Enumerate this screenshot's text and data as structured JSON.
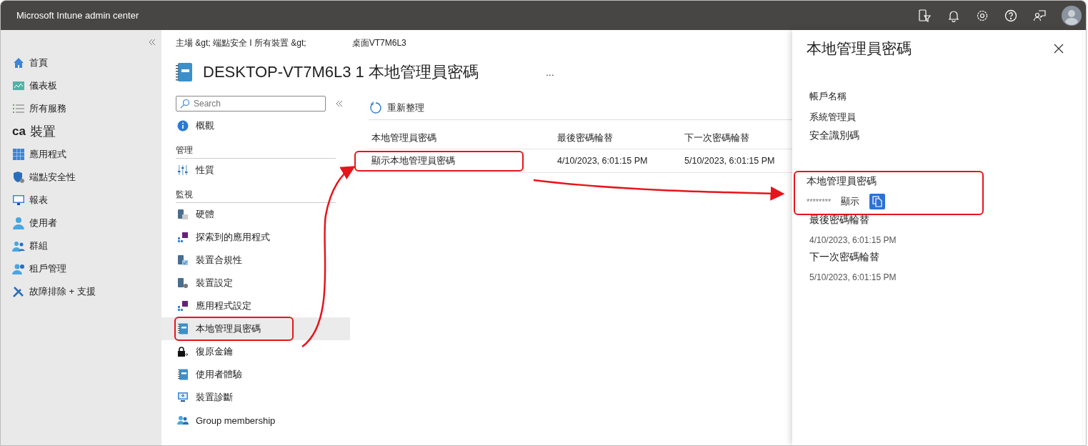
{
  "window": {
    "title": "Microsoft Intune admin center"
  },
  "nav": {
    "items": [
      {
        "label": "首頁",
        "selected": false
      },
      {
        "label": "儀表板",
        "selected": false
      },
      {
        "label": "所有服務",
        "selected": false
      },
      {
        "label": "裝置",
        "prefix": "ca",
        "selected": false
      },
      {
        "label": "應用程式",
        "selected": false
      },
      {
        "label": "端點安全性",
        "selected": false
      },
      {
        "label": "報表",
        "selected": false
      },
      {
        "label": "使用者",
        "selected": false
      },
      {
        "label": "群組",
        "selected": false
      },
      {
        "label": "租戶管理",
        "selected": false
      },
      {
        "label": "故障排除 + 支援",
        "selected": false
      }
    ]
  },
  "breadcrumb": [
    "主場 &gt;  端點安全 I 所有裝置 &gt;",
    "桌面VT7M6L3"
  ],
  "page_title": "DESKTOP-VT7M6L3 1 本地管理員密碼",
  "more": "...",
  "subnav": {
    "search": {
      "placeholder": "Search"
    },
    "items": [
      {
        "kind": "item",
        "label": "概觀",
        "selected": false,
        "highlighted": false
      },
      {
        "kind": "section",
        "label": "管理"
      },
      {
        "kind": "item",
        "label": "性質",
        "selected": false,
        "highlighted": false
      },
      {
        "kind": "section",
        "label": "監視"
      },
      {
        "kind": "item",
        "label": "硬體",
        "selected": false,
        "highlighted": false
      },
      {
        "kind": "item",
        "label": "探索到的應用程式",
        "selected": false,
        "highlighted": false
      },
      {
        "kind": "item",
        "label": "裝置合規性",
        "selected": false,
        "highlighted": false
      },
      {
        "kind": "item",
        "label": "裝置設定",
        "selected": false,
        "highlighted": false
      },
      {
        "kind": "item",
        "label": "應用程式設定",
        "selected": false,
        "highlighted": false
      },
      {
        "kind": "item",
        "label": "本地管理員密碼",
        "selected": true,
        "highlighted": true
      },
      {
        "kind": "item",
        "label": "復原金鑰",
        "selected": false,
        "highlighted": false
      },
      {
        "kind": "item",
        "label": "使用者體驗",
        "selected": false,
        "highlighted": false
      },
      {
        "kind": "item",
        "label": "裝置診斷",
        "selected": false,
        "highlighted": false
      },
      {
        "kind": "item",
        "label": "Group membership",
        "selected": false,
        "highlighted": false
      }
    ]
  },
  "toolbar": {
    "refresh": "重新整理"
  },
  "table": {
    "columns": [
      "本地管理員密碼",
      "最後密碼輪替",
      "下一次密碼輪替"
    ],
    "rows": [
      {
        "cells": [
          "顯示本地管理員密碼",
          "4/10/2023, 6:01:15 PM",
          "5/10/2023, 6:01:15 PM"
        ],
        "highlighted": true
      }
    ]
  },
  "panel": {
    "title": "本地管理員密碼",
    "fields": [
      {
        "kind": "text",
        "label": "帳戶名稱",
        "value": "系統管理員",
        "highlighted": false
      },
      {
        "kind": "text",
        "label": "安全識別碼",
        "highlighted": false
      },
      {
        "kind": "secret",
        "label": "本地管理員密碼",
        "value": "********",
        "action": "顯示",
        "highlighted": true
      },
      {
        "kind": "text",
        "label": "最後密碼輪替",
        "value": "4/10/2023, 6:01:15 PM",
        "highlighted": false
      },
      {
        "kind": "text",
        "label": "下一次密碼輪替",
        "value": "5/10/2023, 6:01:15 PM",
        "highlighted": false
      }
    ]
  }
}
